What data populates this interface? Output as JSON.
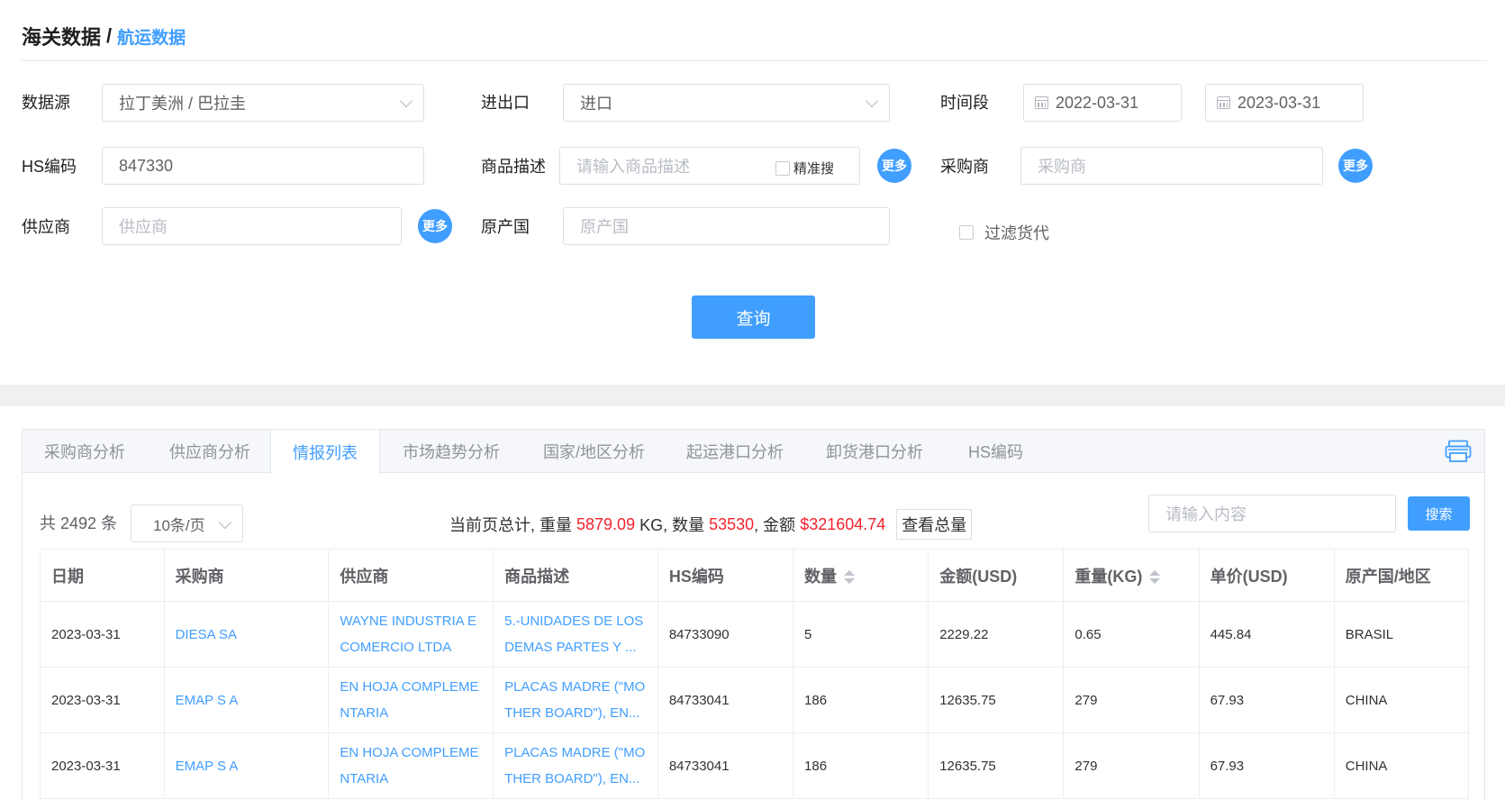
{
  "breadcrumb": {
    "root": "海关数据",
    "separator": "/",
    "current": "航运数据"
  },
  "form": {
    "data_source": {
      "label": "数据源",
      "value": "拉丁美洲 / 巴拉圭"
    },
    "import_export": {
      "label": "进出口",
      "value": "进口"
    },
    "period": {
      "label": "时间段",
      "start": "2022-03-31",
      "separator": "-",
      "end": "2023-03-31"
    },
    "hs_code": {
      "label": "HS编码",
      "value": "847330"
    },
    "product_desc": {
      "label": "商品描述",
      "placeholder": "请输入商品描述",
      "precise_label": "精准搜",
      "more_label": "更多"
    },
    "buyer": {
      "label": "采购商",
      "placeholder": "采购商",
      "more_label": "更多"
    },
    "supplier": {
      "label": "供应商",
      "placeholder": "供应商",
      "more_label": "更多"
    },
    "origin": {
      "label": "原产国",
      "placeholder": "原产国"
    },
    "filter_forwarder": {
      "label": "过滤货代"
    },
    "query_button": "查询"
  },
  "tabs": [
    "采购商分析",
    "供应商分析",
    "情报列表",
    "市场趋势分析",
    "国家/地区分析",
    "起运港口分析",
    "卸货港口分析",
    "HS编码"
  ],
  "active_tab": "情报列表",
  "list": {
    "total_prefix": "共",
    "total_count": "2492",
    "total_suffix": "条",
    "page_size": "10条/页",
    "summary": {
      "prefix": "当前页总计, 重量 ",
      "weight": "5879.09",
      "weight_unit": " KG, 数量 ",
      "quantity": "53530",
      "amount_label": ", 金额 ",
      "amount": "$321604.74",
      "total_button": "查看总量"
    },
    "search_placeholder": "请输入内容",
    "search_button": "搜索"
  },
  "table": {
    "headers": [
      "日期",
      "采购商",
      "供应商",
      "商品描述",
      "HS编码",
      "数量",
      "金额(USD)",
      "重量(KG)",
      "单价(USD)",
      "原产国/地区"
    ],
    "rows": [
      [
        "2023-03-31",
        "DIESA SA",
        "WAYNE INDUSTRIA E COMERCIO LTDA",
        "5.-UNIDADES DE LOS DEMAS PARTES Y ...",
        "84733090",
        "5",
        "2229.22",
        "0.65",
        "445.84",
        "BRASIL"
      ],
      [
        "2023-03-31",
        "EMAP S A",
        "EN HOJA COMPLEMENTARIA",
        "PLACAS MADRE (\"MOTHER BOARD\"), EN...",
        "84733041",
        "186",
        "12635.75",
        "279",
        "67.93",
        "CHINA"
      ],
      [
        "2023-03-31",
        "EMAP S A",
        "EN HOJA COMPLEMENTARIA",
        "PLACAS MADRE (\"MOTHER BOARD\"), EN...",
        "84733041",
        "186",
        "12635.75",
        "279",
        "67.93",
        "CHINA"
      ]
    ]
  },
  "colors": {
    "accent": "#409eff",
    "highlight": "#f5222d"
  },
  "icons": [
    "chevron-down-icon",
    "calendar-icon",
    "print-icon",
    "sort-icon"
  ]
}
